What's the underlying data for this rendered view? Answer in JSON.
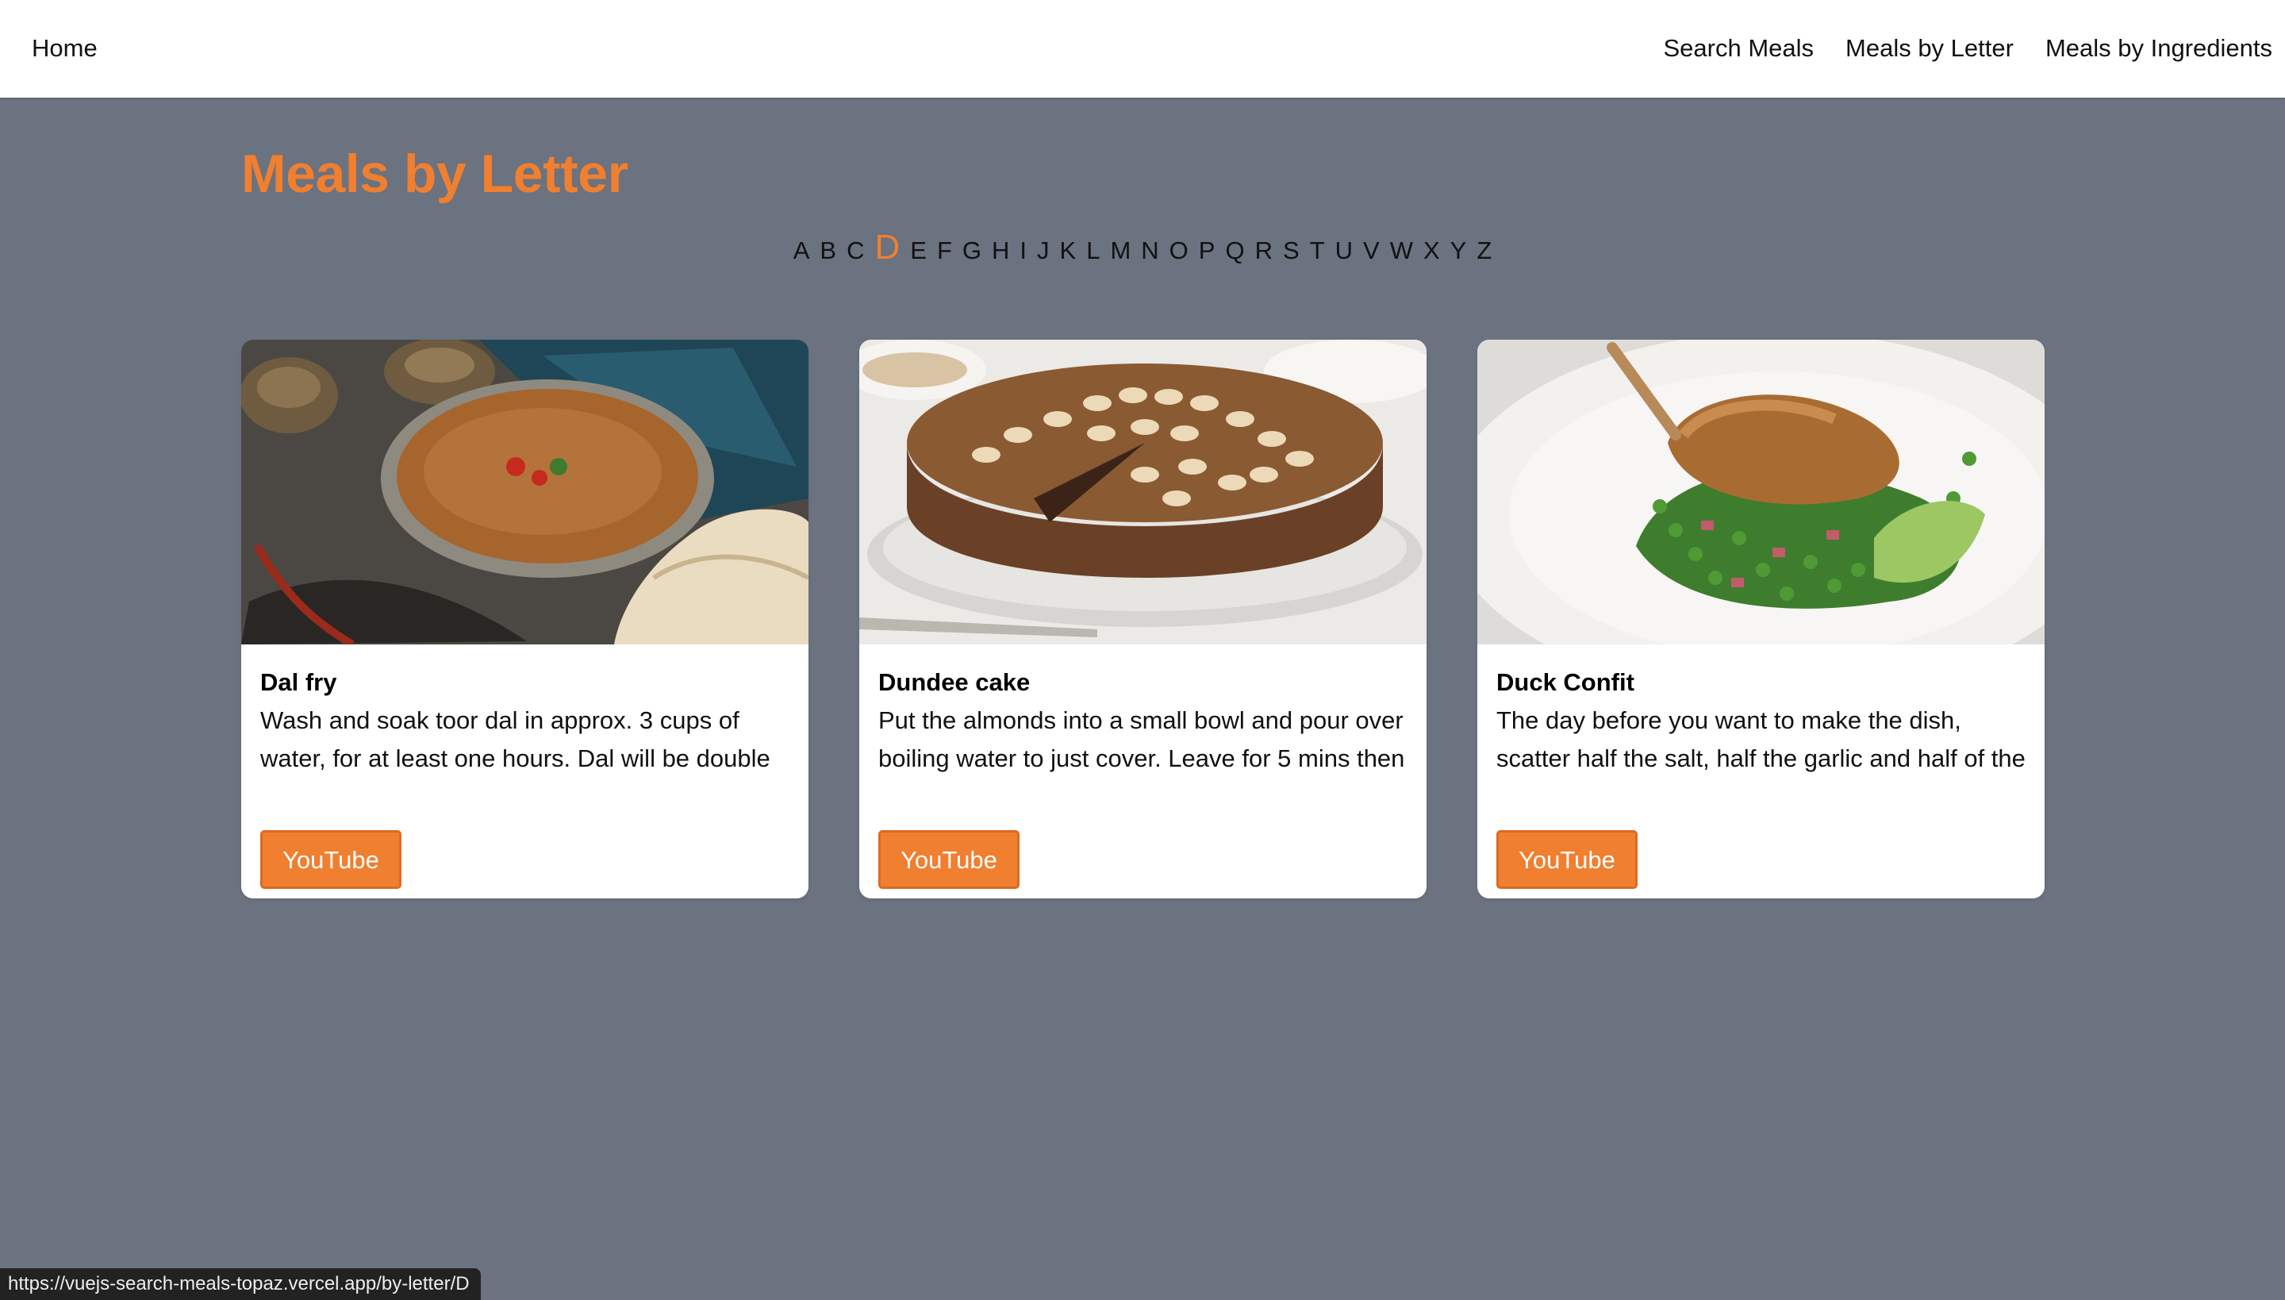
{
  "nav": {
    "home": "Home",
    "links": [
      "Search Meals",
      "Meals by Letter",
      "Meals by Ingredients"
    ]
  },
  "page": {
    "title": "Meals by Letter",
    "active_letter": "D"
  },
  "letters": [
    "A",
    "B",
    "C",
    "D",
    "E",
    "F",
    "G",
    "H",
    "I",
    "J",
    "K",
    "L",
    "M",
    "N",
    "O",
    "P",
    "Q",
    "R",
    "S",
    "T",
    "U",
    "V",
    "W",
    "X",
    "Y",
    "Z"
  ],
  "meals": [
    {
      "name": "Dal fry",
      "description": "Wash and soak toor dal in approx. 3 cups of water, for at least one hours. Dal will be double",
      "button": "YouTube"
    },
    {
      "name": "Dundee cake",
      "description": "Put the almonds into a small bowl and pour over boiling water to just cover. Leave for 5 mins then",
      "button": "YouTube"
    },
    {
      "name": "Duck Confit",
      "description": "The day before you want to make the dish, scatter half the salt, half the garlic and half of the",
      "button": "YouTube"
    }
  ],
  "status_bar": {
    "url": "https://vuejs-search-meals-topaz.vercel.app/by-letter/D"
  },
  "colors": {
    "accent": "#f07f2f",
    "background": "#6b7280",
    "card": "#ffffff"
  }
}
